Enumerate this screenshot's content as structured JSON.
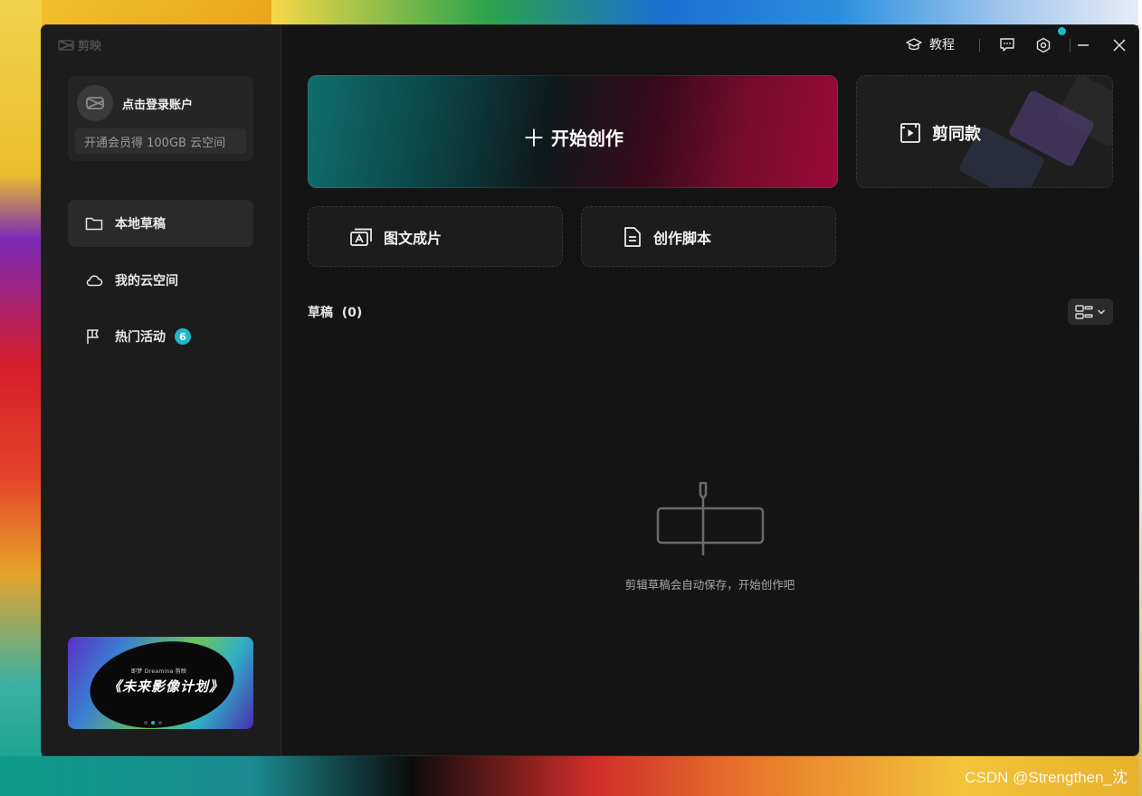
{
  "app": {
    "name": "剪映"
  },
  "account": {
    "login_label": "点击登录账户",
    "vip_promo": "开通会员得 100GB 云空间"
  },
  "sidebar": {
    "items": [
      {
        "label": "本地草稿",
        "icon": "folder-icon",
        "active": true
      },
      {
        "label": "我的云空间",
        "icon": "cloud-icon",
        "active": false
      },
      {
        "label": "热门活动",
        "icon": "flag-icon",
        "active": false,
        "badge": "6"
      }
    ]
  },
  "banner": {
    "brand": "即梦 Dreamina  剪映",
    "title": "《未来影像计划》"
  },
  "titlebar": {
    "tutorial_label": "教程",
    "icons": [
      "mortarboard-icon",
      "feedback-icon",
      "settings-icon",
      "minimize-icon",
      "close-icon"
    ],
    "settings_has_notification": true
  },
  "main": {
    "start_create_label": "开始创作",
    "template_label": "剪同款",
    "tools": [
      {
        "label": "图文成片",
        "icon": "text-to-video-icon"
      },
      {
        "label": "创作脚本",
        "icon": "script-document-icon"
      }
    ],
    "drafts": {
      "label": "草稿",
      "count": "(0)"
    },
    "empty_text": "剪辑草稿会自动保存，开始创作吧"
  },
  "watermark": "CSDN @Strengthen_沈",
  "colors": {
    "accent": "#1fb9c8",
    "window_bg": "#141414",
    "sidebar_bg": "#1c1c1c"
  }
}
